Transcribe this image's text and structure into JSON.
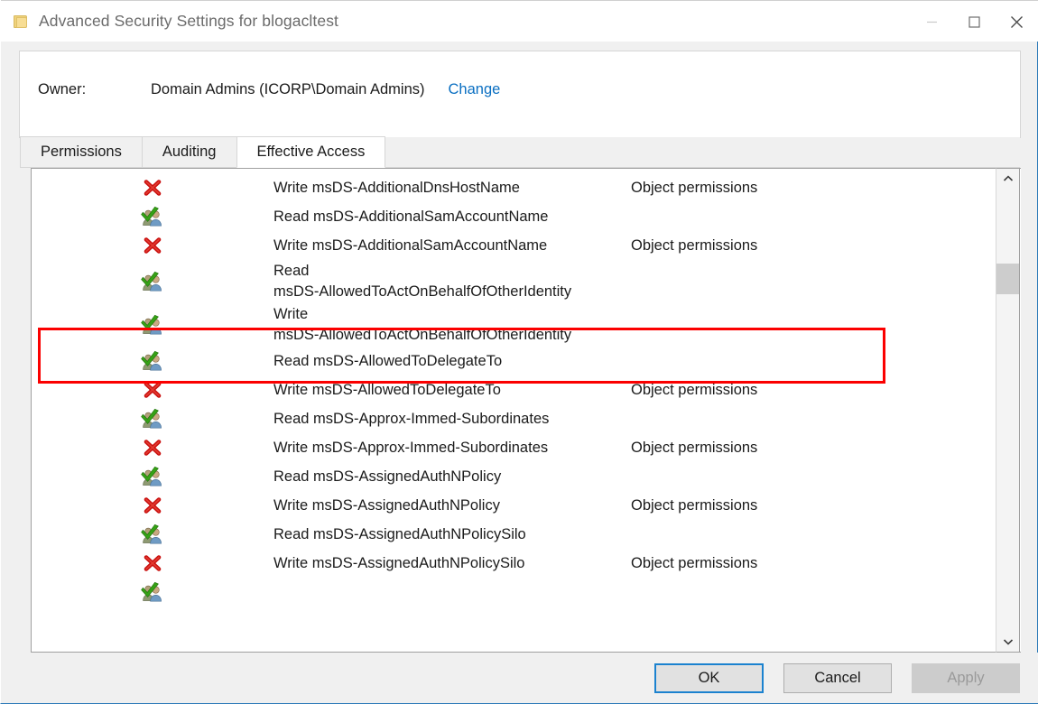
{
  "window": {
    "title": "Advanced Security Settings for blogacltest",
    "icon": "folder-icon",
    "minimize_label": "—",
    "maximize_label": "□",
    "close_label": "✕"
  },
  "owner": {
    "label": "Owner:",
    "value": "Domain Admins (ICORP\\Domain Admins)",
    "change_link": "Change"
  },
  "tabs": [
    {
      "label": "Permissions",
      "active": false
    },
    {
      "label": "Auditing",
      "active": false
    },
    {
      "label": "Effective Access",
      "active": true
    }
  ],
  "list": {
    "rows": [
      {
        "access": "allow",
        "name": "",
        "permission": "",
        "clipped": true
      },
      {
        "access": "deny",
        "name": "Write msDS-AdditionalDnsHostName",
        "permission": "Object permissions"
      },
      {
        "access": "allow",
        "name": "Read msDS-AdditionalSamAccountName",
        "permission": ""
      },
      {
        "access": "deny",
        "name": "Write msDS-AdditionalSamAccountName",
        "permission": "Object permissions"
      },
      {
        "access": "allow",
        "name": "Read\nmsDS-AllowedToActOnBehalfOfOtherIdentity",
        "permission": "",
        "tall": true
      },
      {
        "access": "allow",
        "name": "Write\nmsDS-AllowedToActOnBehalfOfOtherIdentity",
        "permission": "",
        "tall": true,
        "highlighted": true
      },
      {
        "access": "allow",
        "name": "Read msDS-AllowedToDelegateTo",
        "permission": ""
      },
      {
        "access": "deny",
        "name": "Write msDS-AllowedToDelegateTo",
        "permission": "Object permissions"
      },
      {
        "access": "allow",
        "name": "Read msDS-Approx-Immed-Subordinates",
        "permission": ""
      },
      {
        "access": "deny",
        "name": "Write msDS-Approx-Immed-Subordinates",
        "permission": "Object permissions"
      },
      {
        "access": "allow",
        "name": "Read msDS-AssignedAuthNPolicy",
        "permission": ""
      },
      {
        "access": "deny",
        "name": "Write msDS-AssignedAuthNPolicy",
        "permission": "Object permissions"
      },
      {
        "access": "allow",
        "name": "Read msDS-AssignedAuthNPolicySilo",
        "permission": ""
      },
      {
        "access": "deny",
        "name": "Write msDS-AssignedAuthNPolicySilo",
        "permission": "Object permissions"
      },
      {
        "access": "allow",
        "name": "",
        "permission": "",
        "clipped": true
      }
    ]
  },
  "scrollbar": {
    "up_icon": "chevron-up-icon",
    "down_icon": "chevron-down-icon"
  },
  "annotation": {
    "color": "#fb0000",
    "target_row": "Write msDS-AllowedToActOnBehalfOfOtherIdentity"
  },
  "footer": {
    "ok_label": "OK",
    "cancel_label": "Cancel",
    "apply_label": "Apply",
    "apply_disabled": true
  },
  "colors": {
    "accent": "#0a6fc2",
    "deny": "#d41515",
    "allow": "#3aa11a",
    "annotation": "#fb0000",
    "title_text": "#6b6b6b"
  }
}
